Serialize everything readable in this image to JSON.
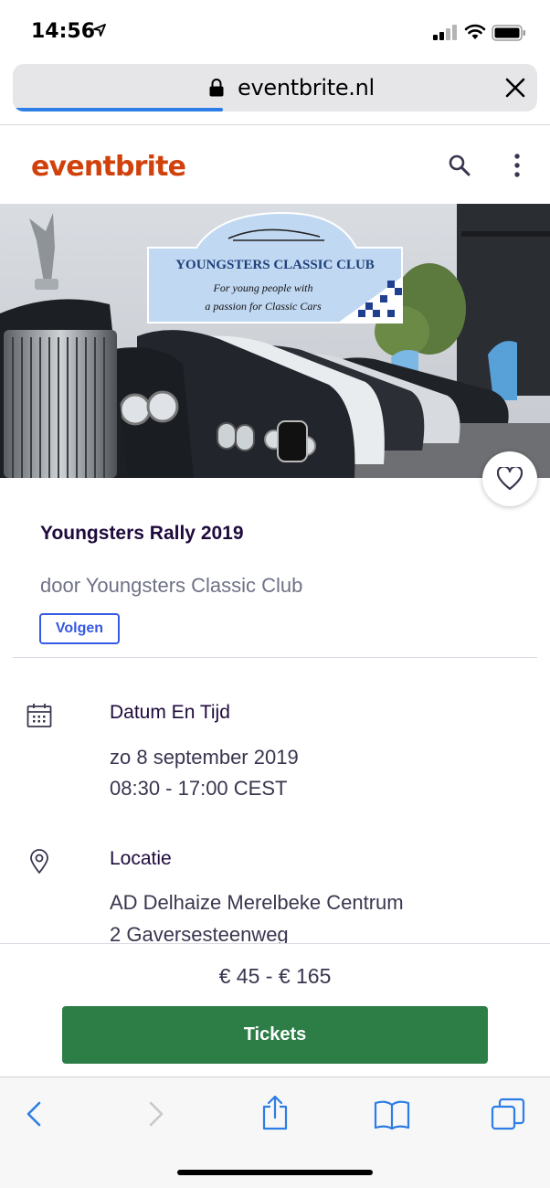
{
  "status_bar": {
    "time": "14:56"
  },
  "browser": {
    "url": "eventbrite.nl",
    "load_progress": 0.4
  },
  "site": {
    "logo": "eventbrite"
  },
  "hero": {
    "banner_title": "YOUNGSTERS CLASSIC CLUB",
    "banner_tagline_1": "For young people with",
    "banner_tagline_2": "a passion for Classic Cars"
  },
  "event": {
    "title": "Youngsters Rally 2019",
    "organizer": "door Youngsters Classic Club",
    "follow_label": "Volgen"
  },
  "date_section": {
    "heading": "Datum En Tijd",
    "date": "zo 8 september 2019",
    "time": "08:30 - 17:00 CEST"
  },
  "location_section": {
    "heading": "Locatie",
    "line1": "AD Delhaize Merelbeke Centrum",
    "line2": "2 Gaversesteenweg"
  },
  "tickets": {
    "price_range": "€ 45 - € 165",
    "button_label": "Tickets"
  },
  "icons": {
    "location": "location-arrow-icon",
    "signal": "cellular-signal-icon",
    "wifi": "wifi-icon",
    "battery": "battery-icon",
    "lock": "lock-icon",
    "close": "close-icon",
    "search": "search-icon",
    "more": "more-vertical-icon",
    "like": "heart-icon",
    "calendar": "calendar-icon",
    "pin": "map-pin-icon",
    "back": "chevron-left-icon",
    "forward": "chevron-right-icon",
    "share": "share-icon",
    "bookmarks": "book-icon",
    "tabs": "tabs-icon"
  },
  "colors": {
    "brand": "#d1410c",
    "primary_text": "#1e0a3c",
    "follow_blue": "#3659e3",
    "ticket_green": "#2d7d46",
    "ios_blue": "#2d7de6"
  }
}
